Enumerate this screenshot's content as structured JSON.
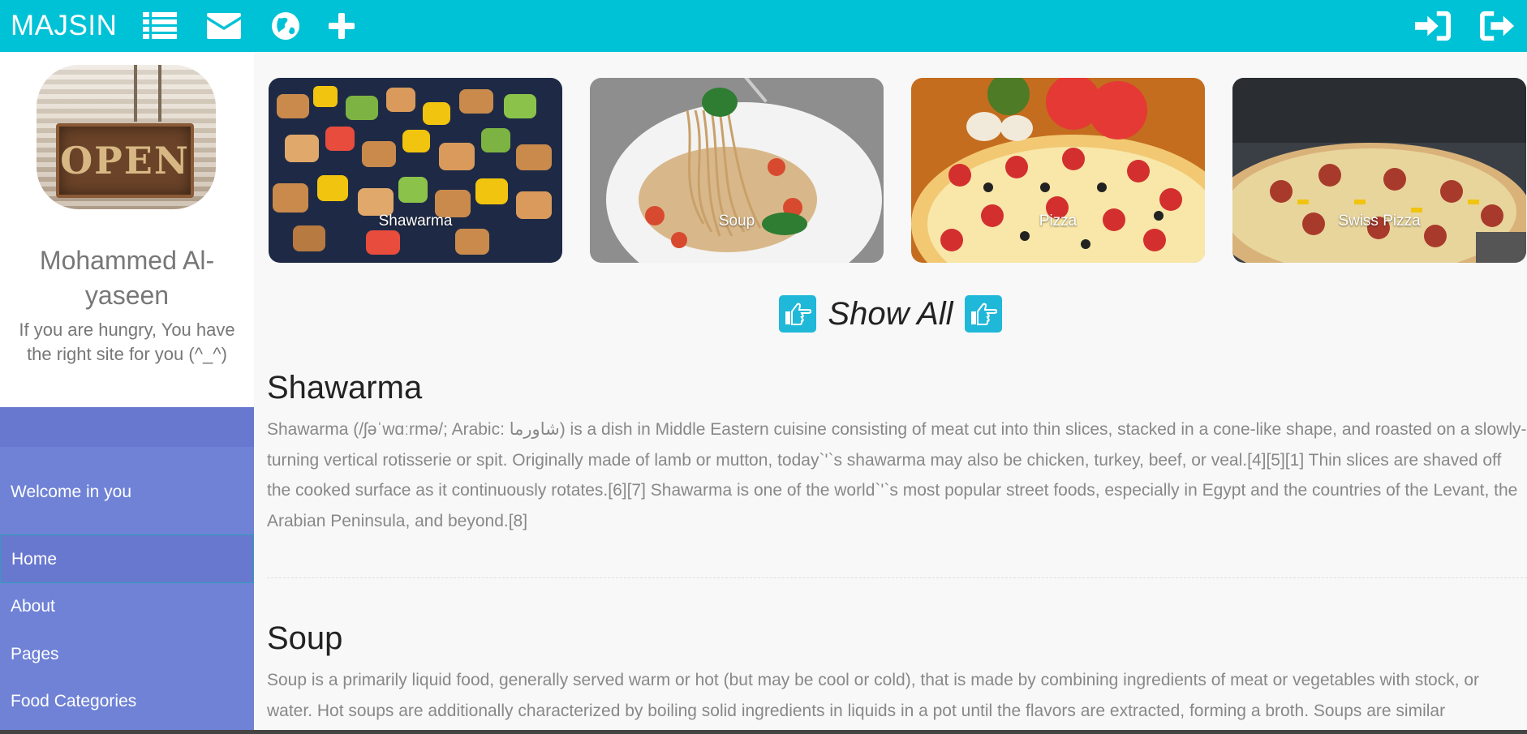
{
  "header": {
    "brand": "MAJSIN",
    "left_icons": [
      "list-icon",
      "envelope-icon",
      "globe-icon",
      "plus-icon"
    ],
    "right_icons": [
      "sign-in-icon",
      "sign-out-icon"
    ]
  },
  "sidebar": {
    "name": "Mohammed Al-yaseen",
    "tagline": "If you are hungry, You have the right site for you (^_^)",
    "welcome": "Welcome in you",
    "items": [
      {
        "label": "Home",
        "active": true
      },
      {
        "label": "About"
      },
      {
        "label": "Pages"
      },
      {
        "label": "Food Categories"
      }
    ]
  },
  "gallery": [
    {
      "label": "Shawarma"
    },
    {
      "label": "Soup"
    },
    {
      "label": "Pizza"
    },
    {
      "label": "Swiss Pizza"
    }
  ],
  "show_all": "Show All",
  "sections": [
    {
      "title": "Shawarma",
      "body": "Shawarma (/ʃəˈwɑːrmə/; Arabic: شاورما) is a dish in Middle Eastern cuisine consisting of meat cut into thin slices, stacked in a cone-like shape, and roasted on a slowly-turning vertical rotisserie or spit. Originally made of lamb or mutton, today`'`s shawarma may also be chicken, turkey, beef, or veal.[4][5][1] Thin slices are shaved off the cooked surface as it continuously rotates.[6][7] Shawarma is one of the world`'`s most popular street foods, especially in Egypt and the countries of the Levant, the Arabian Peninsula, and beyond.[8]"
    },
    {
      "title": "Soup",
      "body": "Soup is a primarily liquid food, generally served warm or hot (but may be cool or cold), that is made by combining ingredients of meat or vegetables with stock, or water. Hot soups are additionally characterized by boiling solid ingredients in liquids in a pot until the flavors are extracted, forming a broth. Soups are similar"
    }
  ],
  "colors": {
    "topbar": "#00c2d6",
    "nav": "#6f82d6",
    "accent": "#1fb8d8"
  }
}
